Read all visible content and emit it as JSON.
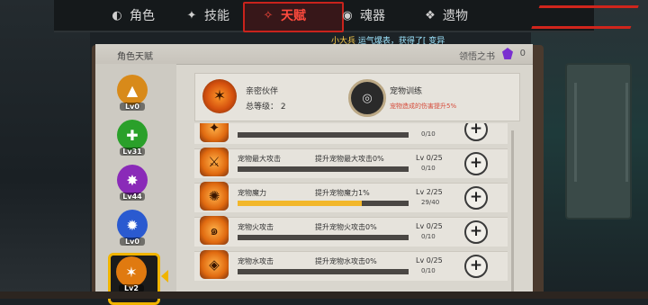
{
  "tabs": [
    {
      "label": "角色",
      "icon": "character-icon"
    },
    {
      "label": "技能",
      "icon": "skill-icon"
    },
    {
      "label": "天赋",
      "icon": "talent-icon"
    },
    {
      "label": "魂器",
      "icon": "soul-icon"
    },
    {
      "label": "遗物",
      "icon": "relic-icon"
    }
  ],
  "ticker": {
    "name": "小大兵",
    "text": "运气爆表，获得了[ 变异"
  },
  "panel": {
    "title": "角色天赋",
    "book_label": "领悟之书",
    "book_count": "0"
  },
  "badges": [
    {
      "level": "Lv0",
      "color": "#d88a1a"
    },
    {
      "level": "Lv31",
      "color": "#2aa02a"
    },
    {
      "level": "Lv44",
      "color": "#8a2ab8"
    },
    {
      "level": "Lv0",
      "color": "#2a5ad0"
    },
    {
      "level": "Lv2",
      "color": "#e07a10"
    }
  ],
  "summary": {
    "name": "亲密伙伴",
    "level_label": "总等级：",
    "level_value": "2",
    "pet_name": "宠物训练",
    "pet_desc": "宠物造成的伤害提升5%"
  },
  "rows": [
    {
      "name": "",
      "desc": "",
      "level": "",
      "progress": "0/10",
      "fill": 0
    },
    {
      "name": "宠物最大攻击",
      "desc": "提升宠物最大攻击0%",
      "level": "Lv 0/25",
      "progress": "0/10",
      "fill": 0
    },
    {
      "name": "宠物魔力",
      "desc": "提升宠物魔力1%",
      "level": "Lv 2/25",
      "progress": "29/40",
      "fill": 0.725
    },
    {
      "name": "宠物火攻击",
      "desc": "提升宠物火攻击0%",
      "level": "Lv 0/25",
      "progress": "0/10",
      "fill": 0
    },
    {
      "name": "宠物水攻击",
      "desc": "提升宠物水攻击0%",
      "level": "Lv 0/25",
      "progress": "0/10",
      "fill": 0
    }
  ]
}
